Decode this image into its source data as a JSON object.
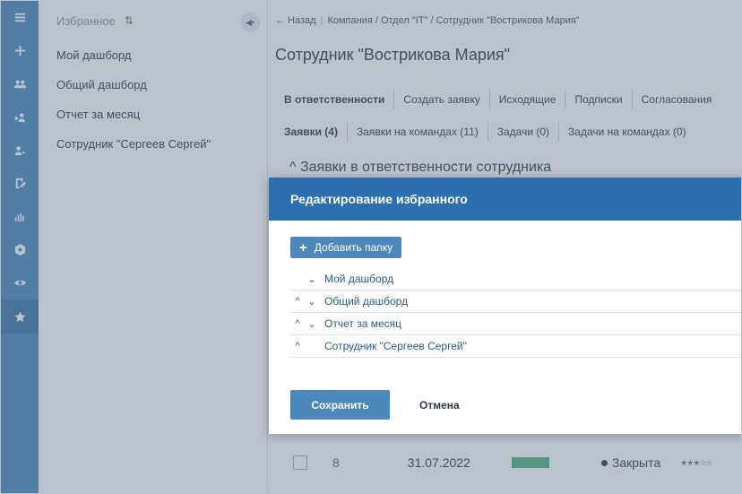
{
  "rail": {
    "items": [
      {
        "icon": "menu-icon"
      },
      {
        "icon": "plus-icon"
      },
      {
        "icon": "users-icon"
      },
      {
        "icon": "add-user-icon"
      },
      {
        "icon": "user-arrow-icon"
      },
      {
        "icon": "edit-doc-icon"
      },
      {
        "icon": "chart-icon"
      },
      {
        "icon": "hexagon-icon"
      },
      {
        "icon": "eye-icon"
      },
      {
        "icon": "star-icon"
      }
    ]
  },
  "favorites_panel": {
    "title": "Избранное",
    "items": [
      "Мой дашборд",
      "Общий дашборд",
      "Отчет за месяц",
      "Сотрудник \"Сергеев Сергей\""
    ]
  },
  "breadcrumb": {
    "back": "← Назад",
    "path": "Компания / Отдел \"IT\" / Сотрудник \"Вострикова Мария\""
  },
  "page": {
    "title": "Сотрудник \"Вострикова Мария\"",
    "tabs": [
      "В ответственности",
      "Создать заявку",
      "Исходящие",
      "Подписки",
      "Согласования"
    ],
    "subtabs": [
      "Заявки (4)",
      "Заявки на командах (11)",
      "Задачи (0)",
      "Задачи на командах (0)"
    ],
    "section_title": "^ Заявки в ответственности сотрудника",
    "row": {
      "number": "8",
      "date": "31.07.2022",
      "status": "Закрыта",
      "stars": "★★★☆☆"
    }
  },
  "modal": {
    "title": "Редактирование избранного",
    "add_folder_label": "Добавить папку",
    "items": [
      {
        "name": "Мой дашборд",
        "up": false,
        "down": true
      },
      {
        "name": "Общий дашборд",
        "up": true,
        "down": true
      },
      {
        "name": "Отчет за месяц",
        "up": true,
        "down": true
      },
      {
        "name": "Сотрудник \"Сергеев Сергей\"",
        "up": true,
        "down": false
      }
    ],
    "save_label": "Сохранить",
    "cancel_label": "Отмена"
  },
  "colors": {
    "rail": "#4d88bd",
    "modal_header": "#2b6fae",
    "button": "#4d88bd",
    "status_bar": "#4fb47a"
  }
}
